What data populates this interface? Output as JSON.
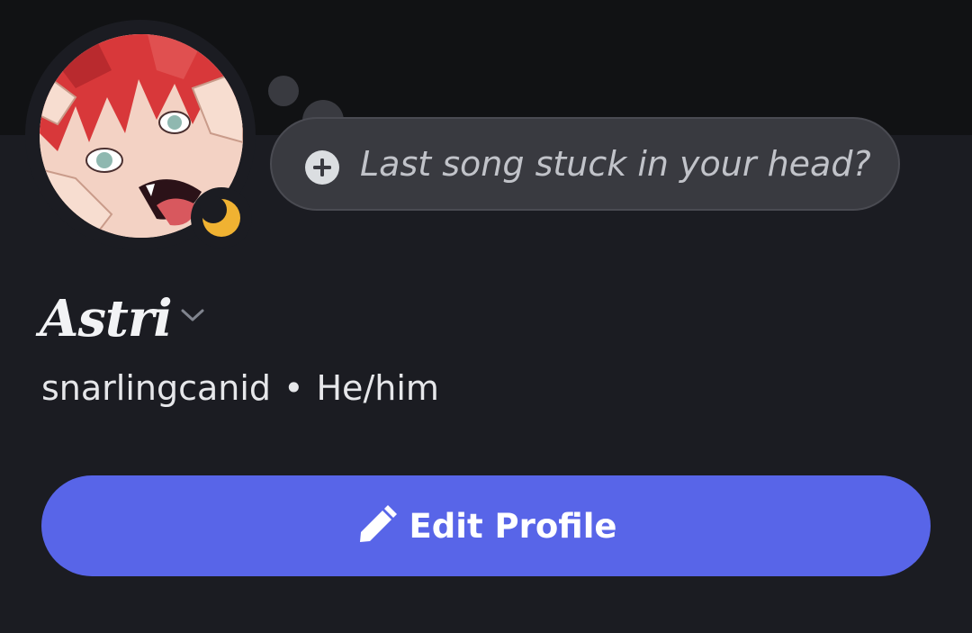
{
  "profile": {
    "display_name": "Astri",
    "username": "snarlingcanid",
    "separator": "•",
    "pronouns": "He/him",
    "status_prompt": "Last song stuck in your head?",
    "status": "idle"
  },
  "actions": {
    "edit_profile_label": "Edit Profile"
  },
  "icons": {
    "status": "moon-icon",
    "add_status": "plus-circle-icon",
    "name_dropdown": "chevron-down-icon",
    "edit": "pencil-icon"
  },
  "colors": {
    "background": "#1b1c22",
    "banner": "#111214",
    "bubble": "#393a40",
    "accent": "#5865e8",
    "idle": "#f0b232"
  }
}
